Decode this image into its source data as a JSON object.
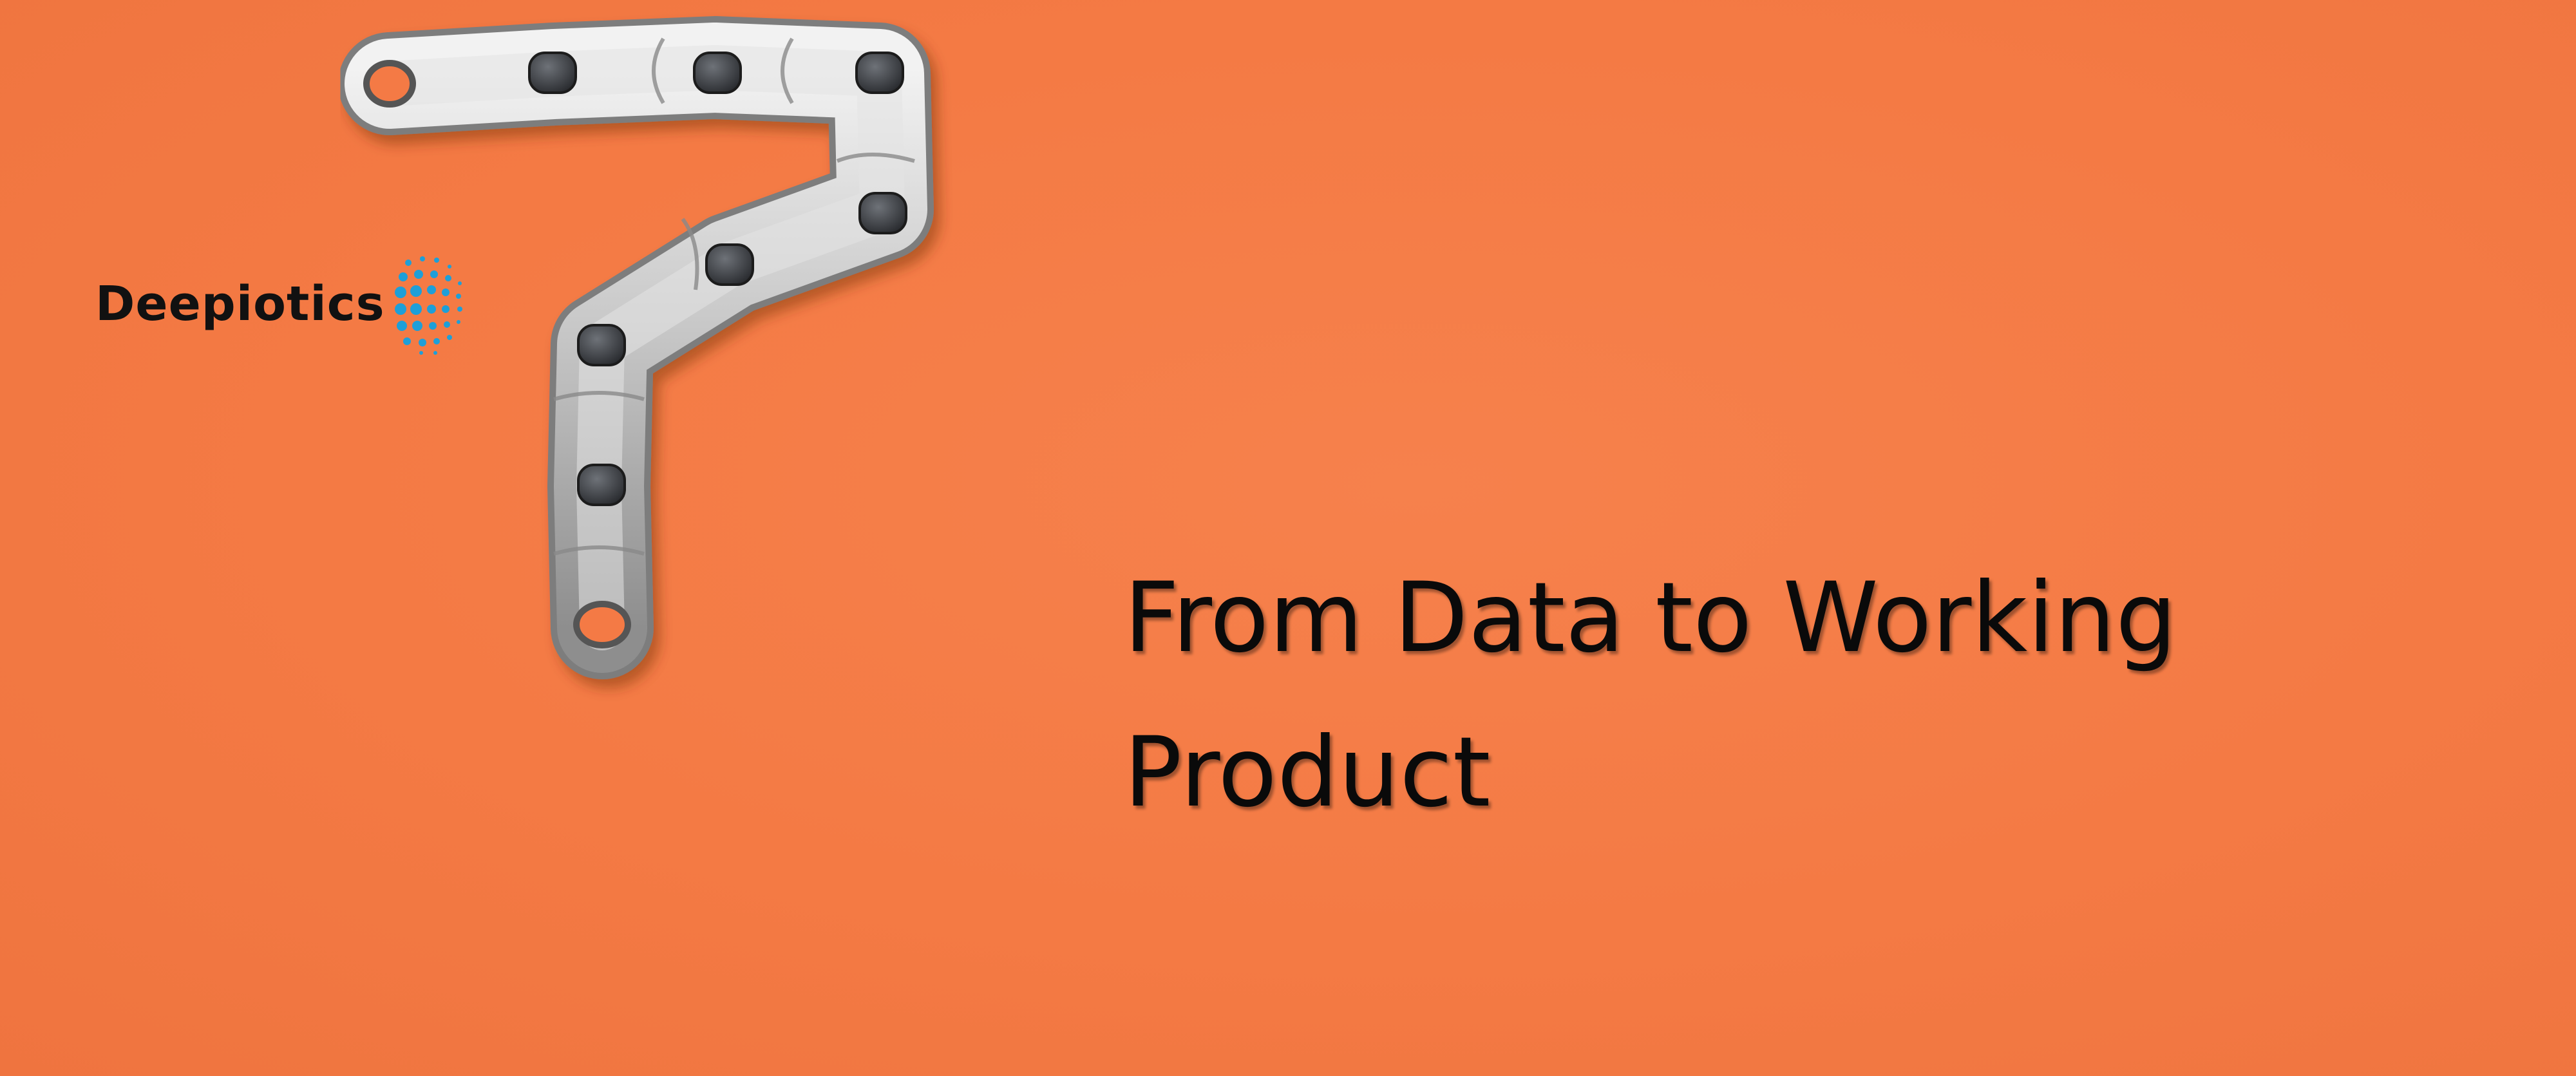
{
  "slide": {
    "background_color": "#f47a45",
    "image": "bicycle-chain-shaped-like-question-mark",
    "logo": {
      "text": "Deepiotics",
      "icon": "dotted-circle-logo-icon",
      "accent_color": "#1e9fd8"
    },
    "headline": {
      "line1": "From Data to Working",
      "line2": "Product"
    }
  }
}
